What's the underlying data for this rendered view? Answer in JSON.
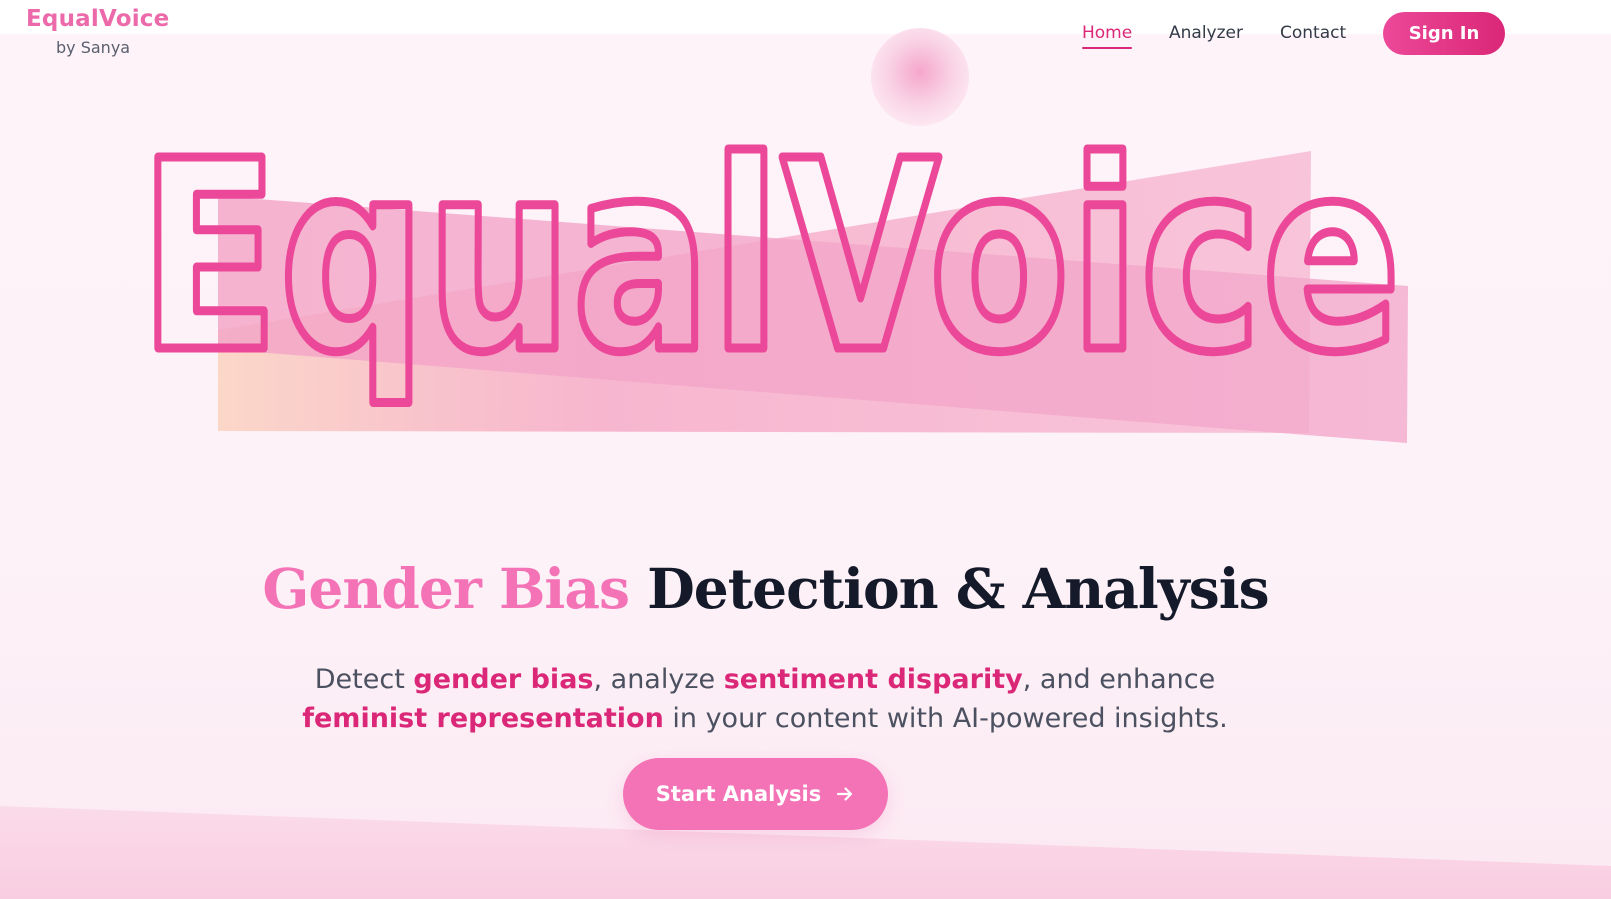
{
  "brand": {
    "name": "EqualVoice",
    "sub": "by Sanya"
  },
  "nav": {
    "items": [
      {
        "label": "Home",
        "active": true
      },
      {
        "label": "Analyzer",
        "active": false
      },
      {
        "label": "Contact",
        "active": false
      }
    ],
    "signin_label": "Sign In"
  },
  "hero": {
    "logo_text": "EqualVoice",
    "headline": {
      "highlight": "Gender Bias",
      "rest": "Detection & Analysis"
    },
    "tagline": {
      "t1": "Detect ",
      "h1": "gender bias",
      "t2": ", analyze ",
      "h2": "sentiment disparity",
      "t3": ", and enhance ",
      "h3": "feminist representation",
      "t4": " in your content with AI-powered insights."
    },
    "cta_label": "Start Analysis",
    "cta_icon": "arrow-right-icon"
  },
  "colors": {
    "brand": "#ec6aa9",
    "accent": "#db2777",
    "cta": "#f472b6",
    "heading_dark": "#141a2a"
  }
}
